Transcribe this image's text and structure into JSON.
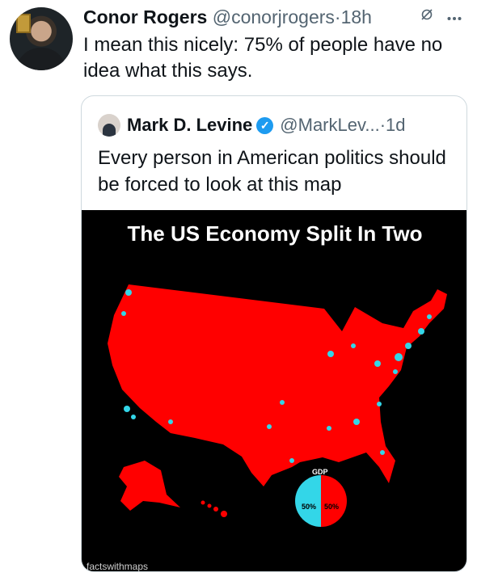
{
  "tweet": {
    "author_name": "Conor Rogers",
    "handle": "@conorjrogers",
    "separator": "·",
    "time": "18h",
    "text": "I mean this nicely: 75% of people have no idea what this says."
  },
  "quoted_tweet": {
    "author_name": "Mark D. Levine",
    "verified_glyph": "✓",
    "handle": "@MarkLev...",
    "separator": "·",
    "time": "1d",
    "text": "Every person in American politics should be forced to look at this map",
    "media": {
      "title": "The US Economy Split In Two",
      "pie_label": "GDP",
      "pie_left_value": "50%",
      "pie_right_value": "50%",
      "credit": "factswithmaps",
      "colors": {
        "map": "#ff0000",
        "metro": "#33d6e8",
        "background": "#000000"
      }
    }
  },
  "icons": [
    "grok-icon",
    "more-icon"
  ]
}
